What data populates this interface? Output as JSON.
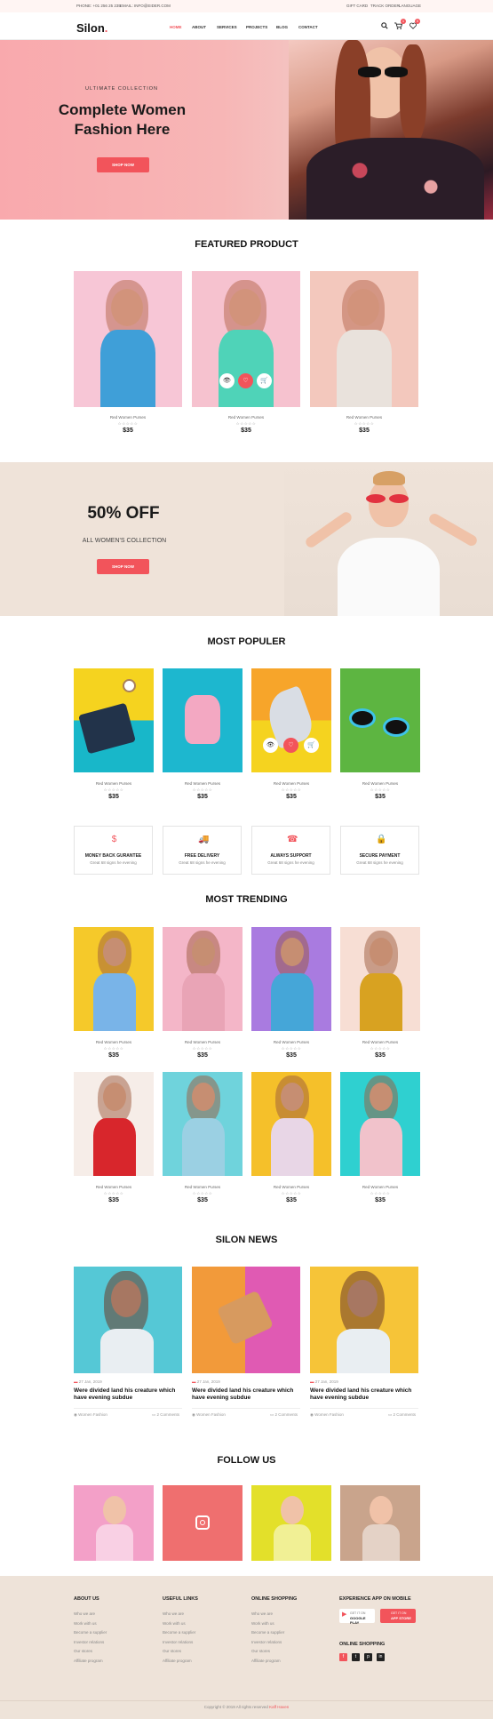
{
  "topbar": {
    "phone": "PHONE: +01 256 25 235",
    "email": "EMAIL: INFO@EIDER.COM",
    "links": [
      "GIFT CARD",
      "TRACK ORDER",
      "LANGUAGE"
    ]
  },
  "header": {
    "logo": "Silon",
    "logo_dot": ".",
    "nav": [
      "HOME",
      "ABOUT",
      "SERVICES",
      "PROJECTS",
      "BLOG",
      "CONTACT"
    ],
    "cart_count": "1",
    "wishlist_count": "0",
    "icons": [
      "search-icon",
      "cart-icon",
      "heart-icon"
    ]
  },
  "hero": {
    "kicker": "ULTIMATE COLLECTION",
    "title_line1": "Complete Women",
    "title_line2": "Fashion Here",
    "button": "SHOP NOW"
  },
  "featured": {
    "title": "FEATURED PRODUCT",
    "items": [
      {
        "name": "Red Women Purses",
        "stars": "☆☆☆☆☆",
        "price": "$35",
        "color1": "#f7c6d6",
        "color2": "#3f9fd8"
      },
      {
        "name": "Red Women Purses",
        "stars": "☆☆☆☆☆",
        "price": "$35",
        "color1": "#f6c2cf",
        "color2": "#4fd3b8"
      },
      {
        "name": "Red Women Purses",
        "stars": "☆☆☆☆☆",
        "price": "$35",
        "color1": "#f3c8bd",
        "color2": "#e9e2dc"
      }
    ]
  },
  "promo": {
    "title": "50% OFF",
    "subtitle": "ALL WOMEN'S COLLECTION",
    "button": "SHOP NOW"
  },
  "popular": {
    "title": "MOST POPULER",
    "items": [
      {
        "name": "Red Women Purses",
        "stars": "☆☆☆☆☆",
        "price": "$35",
        "bg": "#f5d31f",
        "bg2": "#18b7c9"
      },
      {
        "name": "Red Women Purses",
        "stars": "☆☆☆☆☆",
        "price": "$35",
        "bg": "#1db7cf",
        "bg2": "#1db7cf"
      },
      {
        "name": "Red Women Purses",
        "stars": "☆☆☆☆☆",
        "price": "$35",
        "bg": "#f7a52a",
        "bg2": "#f5d31f"
      },
      {
        "name": "Red Women Purses",
        "stars": "☆☆☆☆☆",
        "price": "$35",
        "bg": "#5db541",
        "bg2": "#5db541"
      }
    ]
  },
  "features": [
    {
      "title": "MONEY BACK GURANTEE",
      "text": "Great 68 signs he evening",
      "icon": "money-icon"
    },
    {
      "title": "FREE DELIVERY",
      "text": "Great 68 signs he evening",
      "icon": "truck-icon"
    },
    {
      "title": "ALWAYS SUPPORT",
      "text": "Great 68 signs he evening",
      "icon": "support-icon"
    },
    {
      "title": "SECURE PAYMENT",
      "text": "Great 68 signs he evening",
      "icon": "secure-icon"
    }
  ],
  "trending": {
    "title": "MOST TRENDING",
    "items": [
      {
        "name": "Red Women Purses",
        "stars": "☆☆☆☆☆",
        "price": "$35",
        "bg": "#f5c92a",
        "dress": "#79b4e8"
      },
      {
        "name": "Red Women Purses",
        "stars": "☆☆☆☆☆",
        "price": "$35",
        "bg": "#f4b6c8",
        "dress": "#e9a4b6"
      },
      {
        "name": "Red Women Purses",
        "stars": "☆☆☆☆☆",
        "price": "$35",
        "bg": "#a97be0",
        "dress": "#45a6d8"
      },
      {
        "name": "Red Women Purses",
        "stars": "☆☆☆☆☆",
        "price": "$35",
        "bg": "#f7ded4",
        "dress": "#d8a221"
      },
      {
        "name": "Red Women Purses",
        "stars": "☆☆☆☆☆",
        "price": "$35",
        "bg": "#f6ede8",
        "dress": "#d8262c"
      },
      {
        "name": "Red Women Purses",
        "stars": "☆☆☆☆☆",
        "price": "$35",
        "bg": "#6fd3dc",
        "dress": "#9bd0e3"
      },
      {
        "name": "Red Women Purses",
        "stars": "☆☆☆☆☆",
        "price": "$35",
        "bg": "#f5c02a",
        "dress": "#e8d6e6"
      },
      {
        "name": "Red Women Purses",
        "stars": "☆☆☆☆☆",
        "price": "$35",
        "bg": "#2fd0d0",
        "dress": "#f1c2cb"
      }
    ]
  },
  "news": {
    "title": "SILON NEWS",
    "items": [
      {
        "date": "27 Jan, 2019",
        "title": "Were divided land his creature which have evening subdue",
        "category": "Women Fashion",
        "comments": "2 Comments",
        "bg": "#55c8d6"
      },
      {
        "date": "27 Jan, 2019",
        "title": "Were divided land his creature which have evening subdue",
        "category": "Women Fashion",
        "comments": "2 Comments",
        "bg": "#e05ab3"
      },
      {
        "date": "27 Jan, 2019",
        "title": "Were divided land his creature which have evening subdue",
        "category": "Women Fashion",
        "comments": "2 Comments",
        "bg": "#f6c438"
      }
    ]
  },
  "follow": {
    "title": "FOLLOW US",
    "tiles": [
      "#f3a0c8",
      "#ef6f6f",
      "#e3e02a",
      "#c9a48c"
    ]
  },
  "footer": {
    "columns": [
      {
        "title": "ABOUT US",
        "links": [
          "Who we are",
          "Work with us",
          "Become a supplier",
          "Investor relations",
          "Our stores",
          "Affiliate program"
        ]
      },
      {
        "title": "USEFUL LINKS",
        "links": [
          "Who we are",
          "Work with us",
          "Become a supplier",
          "Investor relations",
          "Our stores",
          "Affiliate program"
        ]
      },
      {
        "title": "ONLINE SHOPPING",
        "links": [
          "Who we are",
          "Work with us",
          "Become a supplier",
          "Investor relations",
          "Our stores",
          "Affiliate program"
        ]
      }
    ],
    "app_title": "EXPERIENCE APP ON MOBILE",
    "google_small": "GET IT ON",
    "google_big": "GOOGLE PLAY",
    "apple_small": "GET IT ON",
    "apple_big": "APP STORE",
    "online_title": "ONLINE SHOPPING",
    "social": [
      "f",
      "t",
      "p",
      "in"
    ],
    "copyright": "Copyright © 2019 All rights reserved",
    "copyright_brand": "Kaff Haven"
  },
  "colors": {
    "accent": "#f2545b",
    "promo_bg": "#efe3d9",
    "footer_bg": "#eee3d9"
  }
}
